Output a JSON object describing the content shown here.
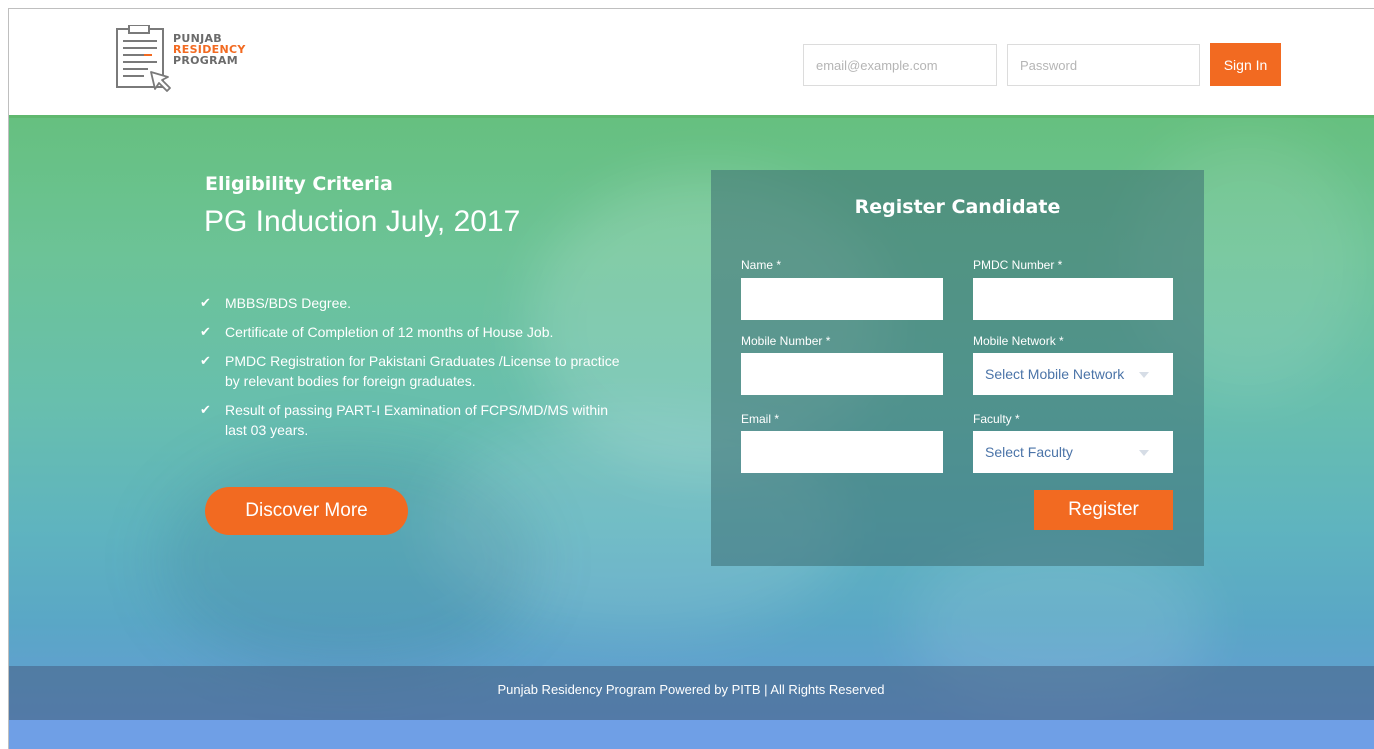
{
  "brand": {
    "line1": "PUNJAB",
    "line2": "RESIDENCY",
    "line3": "PROGRAM",
    "accent_color": "#f26a21",
    "text_color": "#6b6b6b"
  },
  "login": {
    "email_placeholder": "email@example.com",
    "password_placeholder": "Password",
    "signin_label": "Sign In"
  },
  "hero": {
    "heading_small": "Eligibility Criteria",
    "heading_large": "PG Induction July, 2017",
    "criteria": [
      "MBBS/BDS Degree.",
      "Certificate of Completion of 12 months of House Job.",
      "PMDC Registration for Pakistani Graduates /License to practice by relevant bodies for foreign graduates.",
      "Result of passing PART-I Examination of FCPS/MD/MS within last 03 years."
    ],
    "check_icon": "checkmark-icon",
    "discover_label": "Discover More"
  },
  "register": {
    "title": "Register Candidate",
    "name_label": "Name *",
    "pmdc_label": "PMDC Number *",
    "mobile_label": "Mobile Number *",
    "network_label": "Mobile Network *",
    "network_value": "Select Mobile Network",
    "email_label": "Email *",
    "faculty_label": "Faculty *",
    "faculty_value": "Select Faculty",
    "register_label": "Register"
  },
  "footer": {
    "text": "Punjab Residency Program Powered by PITB | All Rights Reserved"
  }
}
